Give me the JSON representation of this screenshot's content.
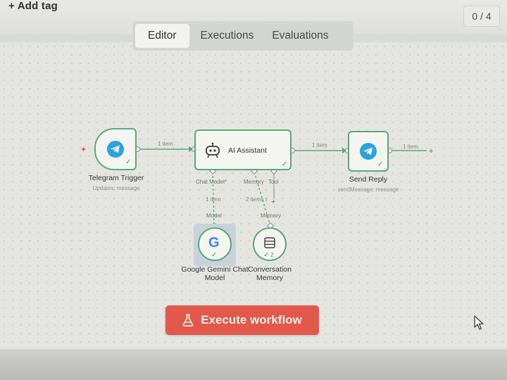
{
  "header": {
    "add_tag": "+ Add tag",
    "counter": "0 / 4"
  },
  "tabs": [
    {
      "label": "Editor",
      "active": true
    },
    {
      "label": "Executions",
      "active": false
    },
    {
      "label": "Evaluations",
      "active": false
    }
  ],
  "nodes": {
    "telegram_trigger": {
      "title": "Telegram Trigger",
      "subtitle": "Updates: message",
      "icon": "telegram-icon"
    },
    "ai_assistant": {
      "title": "AI Assistant",
      "icon": "robot-icon"
    },
    "send_reply": {
      "title": "Send Reply",
      "subtitle": "sendMessage: message",
      "icon": "telegram-icon"
    },
    "gemini": {
      "title_line1": "Google Gemini Chat",
      "title_line2": "Model",
      "icon": "google-icon"
    },
    "memory": {
      "title_line1": "Conversation",
      "title_line2": "Memory",
      "icon": "database-icon",
      "count": "2"
    }
  },
  "connections": {
    "trigger_to_assistant": "1 item",
    "assistant_to_reply": "1 item",
    "reply_out": "1 item",
    "model_items": "1 item",
    "memory_items": "2 items t"
  },
  "ports": {
    "chat_model": "Chat Model*",
    "memory": "Memory",
    "tool": "Tool",
    "model": "Model",
    "memory_in": "Memory"
  },
  "actions": {
    "execute": "Execute workflow"
  },
  "colors": {
    "accent_green": "#5aa97a",
    "execute_red": "#e2584a",
    "telegram_blue": "#2aa3de"
  }
}
